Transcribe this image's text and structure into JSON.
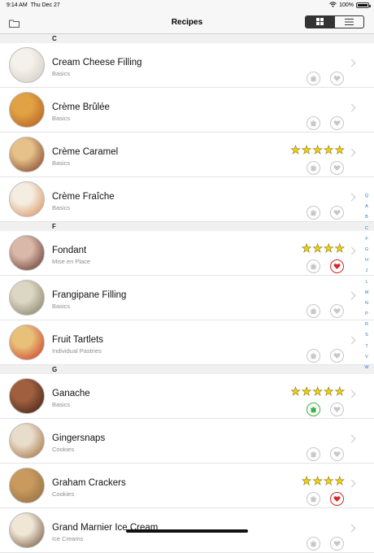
{
  "status": {
    "time": "9:14 AM",
    "date": "Thu Dec 27",
    "battery": "100%"
  },
  "nav": {
    "title": "Recipes"
  },
  "view_mode": {
    "options": [
      "grid",
      "list"
    ],
    "selected": "grid"
  },
  "sections": [
    {
      "letter": "C",
      "items": [
        {
          "name": "Cream Cheese Filling",
          "category": "Basics",
          "stars": 0,
          "cooked": false,
          "favorite": false,
          "thumb": [
            "#cfc9c0",
            "#f4f1ea"
          ]
        },
        {
          "name": "Crème Brûlée",
          "category": "Basics",
          "stars": 0,
          "cooked": false,
          "favorite": false,
          "thumb": [
            "#b0561d",
            "#e0a244"
          ]
        },
        {
          "name": "Crème Caramel",
          "category": "Basics",
          "stars": 5,
          "cooked": false,
          "favorite": false,
          "thumb": [
            "#7a3520",
            "#e6c28a"
          ]
        },
        {
          "name": "Crème Fraîche",
          "category": "Basics",
          "stars": 0,
          "cooked": false,
          "favorite": false,
          "thumb": [
            "#d58a4e",
            "#f5ede2"
          ]
        }
      ]
    },
    {
      "letter": "F",
      "items": [
        {
          "name": "Fondant",
          "category": "Mise en Place",
          "stars": 4,
          "cooked": false,
          "favorite": true,
          "thumb": [
            "#5a2e24",
            "#d9b8aa"
          ]
        },
        {
          "name": "Frangipane Filling",
          "category": "Basics",
          "stars": 0,
          "cooked": false,
          "favorite": false,
          "thumb": [
            "#7b7a5c",
            "#dcd6c4"
          ]
        },
        {
          "name": "Fruit Tartlets",
          "category": "Individual Pastries",
          "stars": 0,
          "cooked": false,
          "favorite": false,
          "thumb": [
            "#c9301f",
            "#e9c07a"
          ]
        }
      ]
    },
    {
      "letter": "G",
      "items": [
        {
          "name": "Ganache",
          "category": "Basics",
          "stars": 5,
          "cooked": true,
          "favorite": false,
          "thumb": [
            "#3a1d12",
            "#a06040"
          ]
        },
        {
          "name": "Gingersnaps",
          "category": "Cookies",
          "stars": 0,
          "cooked": false,
          "favorite": false,
          "thumb": [
            "#a0652e",
            "#e8dccb"
          ]
        },
        {
          "name": "Graham Crackers",
          "category": "Cookies",
          "stars": 4,
          "cooked": false,
          "favorite": true,
          "thumb": [
            "#8c6a3c",
            "#c89a5e"
          ]
        },
        {
          "name": "Grand Marnier Ice Cream",
          "category": "Ice Creams",
          "stars": 0,
          "cooked": false,
          "favorite": false,
          "thumb": [
            "#6b4a30",
            "#efe6d6"
          ]
        }
      ]
    }
  ],
  "index_letters": [
    "Q",
    "A",
    "B",
    "C",
    "F",
    "G",
    "H",
    "J",
    "L",
    "M",
    "N",
    "P",
    "R",
    "S",
    "T",
    "V",
    "W"
  ],
  "colors": {
    "link": "#1e7bd8",
    "star": "#f6d20c",
    "cooked": "#3cb043",
    "favorite": "#d62828"
  },
  "icons": {
    "folder": "folder-icon",
    "grid": "grid-icon",
    "list": "list-icon",
    "cooked": "pot-icon",
    "favorite": "heart-icon",
    "disclosure": "chevron-right-icon"
  }
}
